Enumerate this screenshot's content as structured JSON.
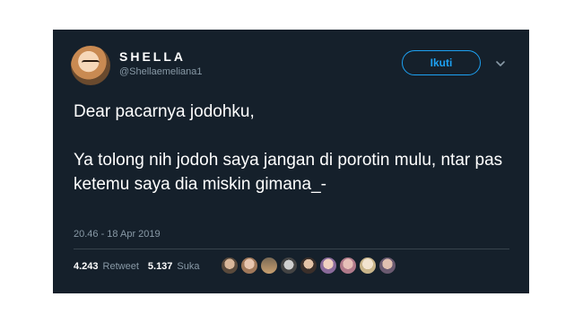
{
  "user": {
    "display_name": "SHELLA",
    "handle": "@Shellaemeliana1"
  },
  "follow_button": {
    "label": "Ikuti"
  },
  "tweet": {
    "text": "Dear pacarnya jodohku,\n\nYa tolong nih jodoh saya jangan di porotin mulu, ntar pas ketemu saya dia miskin gimana_-",
    "timestamp": "20.46 - 18 Apr 2019"
  },
  "stats": {
    "retweets_count": "4.243",
    "retweets_label": "Retweet",
    "likes_count": "5.137",
    "likes_label": "Suka"
  },
  "liker_avatars": [
    "avatar-1",
    "avatar-2",
    "avatar-3",
    "avatar-4",
    "avatar-5",
    "avatar-6",
    "avatar-7",
    "avatar-8",
    "avatar-9"
  ],
  "colors": {
    "card_background": "#15202b",
    "accent": "#1da1f2",
    "secondary_text": "#8899a6"
  }
}
